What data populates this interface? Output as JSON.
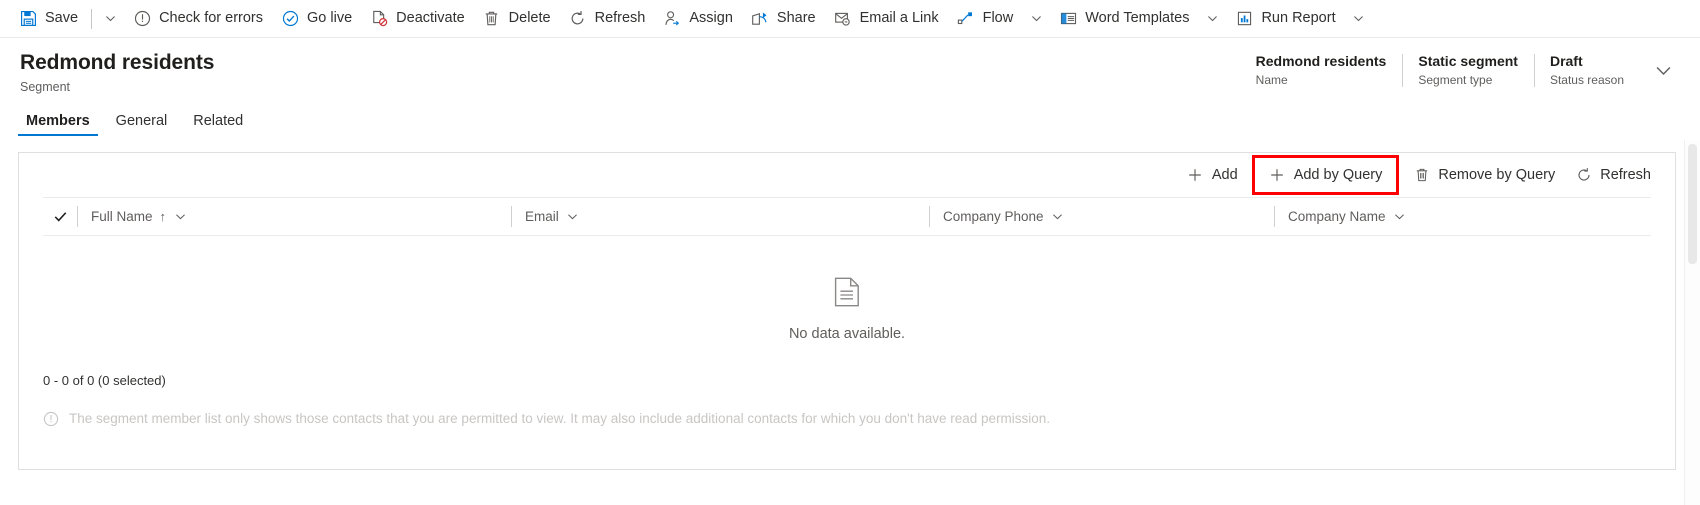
{
  "command_bar": {
    "items": [
      {
        "id": "save",
        "label": "Save",
        "icon": "save-icon",
        "has_caret": true
      },
      {
        "id": "check-for-errors",
        "label": "Check for errors",
        "icon": "error-circle-icon",
        "has_caret": false
      },
      {
        "id": "go-live",
        "label": "Go live",
        "icon": "check-circle-icon",
        "has_caret": false
      },
      {
        "id": "deactivate",
        "label": "Deactivate",
        "icon": "deactivate-icon",
        "has_caret": false
      },
      {
        "id": "delete",
        "label": "Delete",
        "icon": "trash-icon",
        "has_caret": false
      },
      {
        "id": "refresh",
        "label": "Refresh",
        "icon": "refresh-icon",
        "has_caret": false
      },
      {
        "id": "assign",
        "label": "Assign",
        "icon": "assign-person-icon",
        "has_caret": false
      },
      {
        "id": "share",
        "label": "Share",
        "icon": "share-icon",
        "has_caret": false
      },
      {
        "id": "email-a-link",
        "label": "Email a Link",
        "icon": "email-link-icon",
        "has_caret": false
      },
      {
        "id": "flow",
        "label": "Flow",
        "icon": "flow-icon",
        "has_caret": true
      },
      {
        "id": "word-templates",
        "label": "Word Templates",
        "icon": "word-template-icon",
        "has_caret": true
      },
      {
        "id": "run-report",
        "label": "Run Report",
        "icon": "report-icon",
        "has_caret": true
      }
    ]
  },
  "header": {
    "title": "Redmond residents",
    "subtitle": "Segment",
    "fields": [
      {
        "value": "Redmond residents",
        "label": "Name"
      },
      {
        "value": "Static segment",
        "label": "Segment type"
      },
      {
        "value": "Draft",
        "label": "Status reason"
      }
    ],
    "expand_icon": "chevron-down-icon"
  },
  "tabs": [
    {
      "label": "Members",
      "active": true
    },
    {
      "label": "General",
      "active": false
    },
    {
      "label": "Related",
      "active": false
    }
  ],
  "grid_toolbar": {
    "items": [
      {
        "id": "add",
        "label": "Add",
        "icon": "plus-icon",
        "highlighted": false
      },
      {
        "id": "add-by-query",
        "label": "Add by Query",
        "icon": "plus-icon",
        "highlighted": true
      },
      {
        "id": "remove-by-query",
        "label": "Remove by Query",
        "icon": "trash-icon",
        "highlighted": false
      },
      {
        "id": "refresh",
        "label": "Refresh",
        "icon": "refresh-icon",
        "highlighted": false
      }
    ]
  },
  "grid": {
    "select_all_icon": "checkmark-icon",
    "columns": [
      {
        "name": "Full Name",
        "sorted": true,
        "sort_direction": "↑",
        "caret": "chevron-down-icon"
      },
      {
        "name": "Email",
        "sorted": false,
        "sort_direction": "",
        "caret": "chevron-down-icon"
      },
      {
        "name": "Company Phone",
        "sorted": false,
        "sort_direction": "",
        "caret": "chevron-down-icon"
      },
      {
        "name": "Company Name",
        "sorted": false,
        "sort_direction": "",
        "caret": "chevron-down-icon"
      }
    ],
    "empty_state": {
      "icon": "document-icon",
      "text": "No data available."
    },
    "pager_text": "0 - 0 of 0 (0 selected)",
    "note": {
      "icon": "info-circle-icon",
      "text": "The segment member list only shows those contacts that you are permitted to view. It may also include additional contacts for which you don't have read permission."
    }
  },
  "colors": {
    "accent": "#0078d4",
    "highlight": "#ff0000",
    "text_primary": "#323130",
    "text_secondary": "#605e5c",
    "border": "#e1dfdd"
  }
}
